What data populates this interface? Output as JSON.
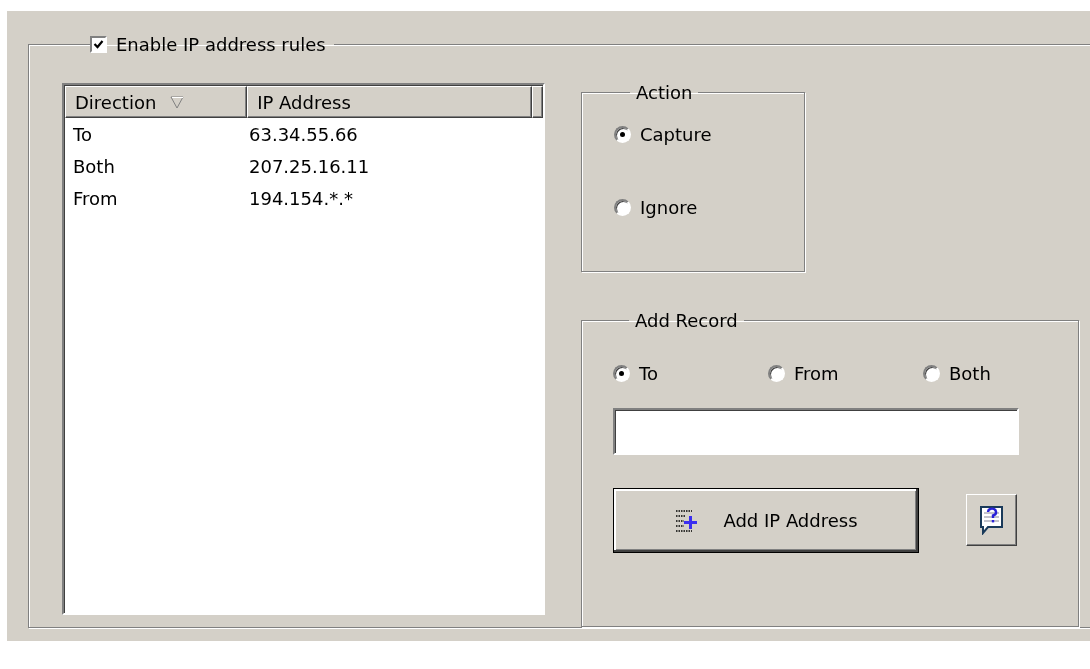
{
  "rules": {
    "label": "Enable IP address rules",
    "checked": true
  },
  "list": {
    "columns": [
      {
        "label": "Direction",
        "sorted": true
      },
      {
        "label": "IP Address",
        "sorted": false
      }
    ],
    "rows": [
      {
        "direction": "To",
        "ip": "63.34.55.66"
      },
      {
        "direction": "Both",
        "ip": "207.25.16.11"
      },
      {
        "direction": "From",
        "ip": "194.154.*.*"
      }
    ]
  },
  "action": {
    "title": "Action",
    "options": [
      {
        "label": "Capture",
        "selected": true
      },
      {
        "label": "Ignore",
        "selected": false
      }
    ]
  },
  "add_record": {
    "title": "Add Record",
    "directions": [
      {
        "label": "To",
        "selected": true
      },
      {
        "label": "From",
        "selected": false
      },
      {
        "label": "Both",
        "selected": false
      }
    ],
    "add_button": "Add IP Address"
  }
}
